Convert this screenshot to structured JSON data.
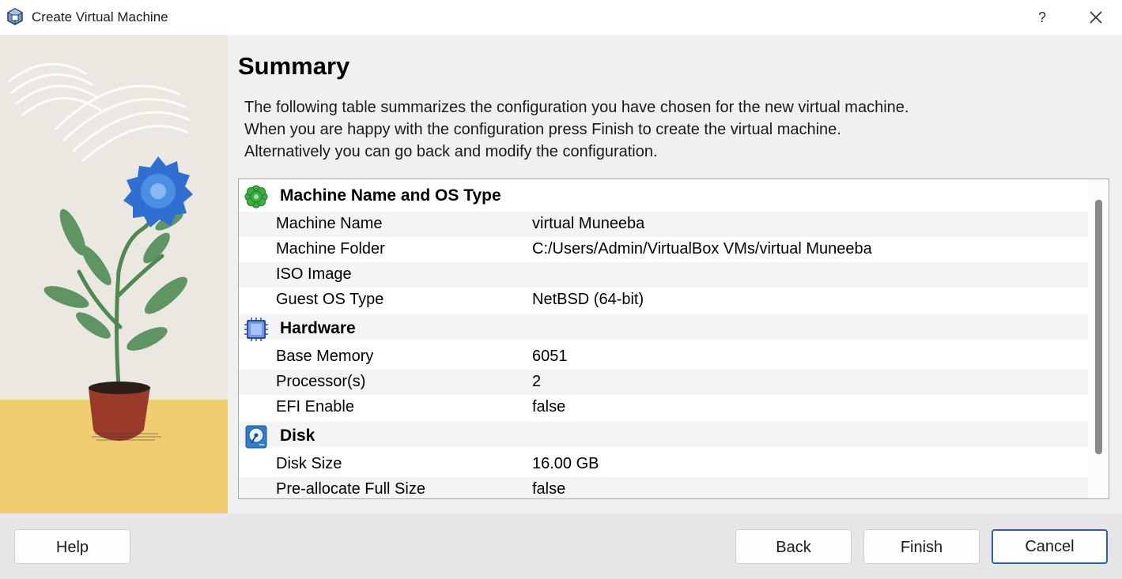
{
  "window": {
    "title": "Create Virtual Machine",
    "help_glyph": "?",
    "icons": {
      "app": "virtualbox-cube-icon",
      "close": "close-icon"
    }
  },
  "page": {
    "heading": "Summary",
    "description": [
      "The following table summarizes the configuration you have chosen for the new virtual machine.",
      "When you are happy with the configuration press Finish to create the virtual machine.",
      "Alternatively you can go back and modify the configuration."
    ]
  },
  "summary": {
    "general": {
      "title": "Machine Name and OS Type",
      "icon": "green-gear-icon",
      "rows": [
        {
          "label": "Machine Name",
          "value": "virtual Muneeba"
        },
        {
          "label": "Machine Folder",
          "value": "C:/Users/Admin/VirtualBox VMs/virtual Muneeba"
        },
        {
          "label": "ISO Image",
          "value": ""
        },
        {
          "label": "Guest OS Type",
          "value": "NetBSD (64-bit)"
        }
      ]
    },
    "hardware": {
      "title": "Hardware",
      "icon": "chip-icon",
      "rows": [
        {
          "label": "Base Memory",
          "value": "6051"
        },
        {
          "label": "Processor(s)",
          "value": "2"
        },
        {
          "label": "EFI Enable",
          "value": "false"
        }
      ]
    },
    "disk": {
      "title": "Disk",
      "icon": "hard-disk-icon",
      "rows": [
        {
          "label": "Disk Size",
          "value": "16.00 GB"
        },
        {
          "label": "Pre-allocate Full Size",
          "value": "false"
        }
      ]
    }
  },
  "buttons": {
    "help": "Help",
    "back": "Back",
    "finish": "Finish",
    "cancel": "Cancel"
  },
  "colors": {
    "accent": "#2b5fb0",
    "section_icon_green": "#3cb043",
    "section_icon_blue": "#4a7fd6"
  }
}
